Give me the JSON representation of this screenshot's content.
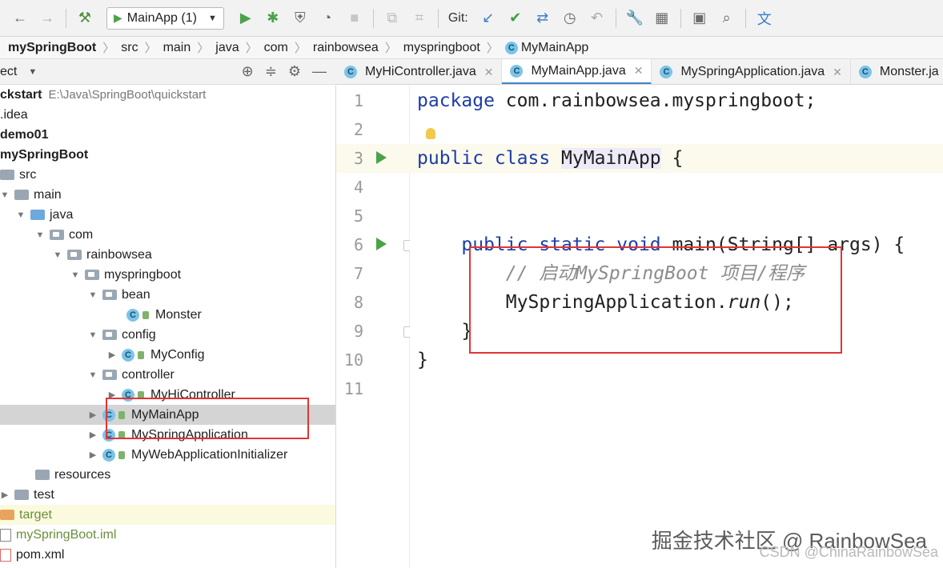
{
  "toolbar": {
    "run_config": "MainApp (1)",
    "git_label": "Git:",
    "icons": [
      "back-arrow-icon",
      "forward-arrow-icon",
      "build-hammer-icon",
      "run-icon",
      "debug-icon",
      "coverage-icon",
      "profile-icon",
      "stop-icon",
      "vcs-icon",
      "settings-wrench-icon",
      "project-structure-icon",
      "terminal-icon",
      "search-icon",
      "translate-icon"
    ]
  },
  "breadcrumb": [
    "mySpringBoot",
    "src",
    "main",
    "java",
    "com",
    "rainbowsea",
    "myspringboot",
    "MyMainApp"
  ],
  "project_panel": {
    "title": "ect",
    "tree": [
      {
        "label": "ckstart",
        "extra": "E:\\Java\\SpringBoot\\quickstart"
      },
      {
        "label": ".idea"
      },
      {
        "label": "demo01"
      },
      {
        "label": "mySpringBoot"
      },
      {
        "label": "src"
      },
      {
        "label": "main"
      },
      {
        "label": "java"
      },
      {
        "label": "com"
      },
      {
        "label": "rainbowsea"
      },
      {
        "label": "myspringboot"
      },
      {
        "label": "bean"
      },
      {
        "label": "Monster"
      },
      {
        "label": "config"
      },
      {
        "label": "MyConfig"
      },
      {
        "label": "controller"
      },
      {
        "label": "MyHiController"
      },
      {
        "label": "MyMainApp"
      },
      {
        "label": "MySpringApplication"
      },
      {
        "label": "MyWebApplicationInitializer"
      },
      {
        "label": "resources"
      },
      {
        "label": "test"
      },
      {
        "label": "target"
      },
      {
        "label": "mySpringBoot.iml"
      },
      {
        "label": "pom.xml"
      }
    ]
  },
  "tabs": [
    {
      "label": "MyHiController.java"
    },
    {
      "label": "MyMainApp.java"
    },
    {
      "label": "MySpringApplication.java"
    },
    {
      "label": "Monster.ja"
    }
  ],
  "editor": {
    "line_numbers": [
      "1",
      "2",
      "3",
      "4",
      "5",
      "6",
      "7",
      "8",
      "9",
      "10",
      "11"
    ],
    "lines": {
      "l1_kw": "package",
      "l1_rest": " com.rainbowsea.myspringboot;",
      "l3_kw": "public class",
      "l3_cls": "MyMainApp",
      "l3_rest": " {",
      "l6_kw": "    public static void",
      "l6_rest": " main(String[] args) {",
      "l7_comment": "        // 启动MySpringBoot 项目/程序",
      "l8_a": "        MySpringApplication.",
      "l8_b": "run",
      "l8_c": "();",
      "l9": "    }",
      "l10": "}"
    }
  },
  "watermark": {
    "main": "掘金技术社区 @ RainbowSea",
    "sub": "CSDN @ChinaRainbowSea"
  }
}
